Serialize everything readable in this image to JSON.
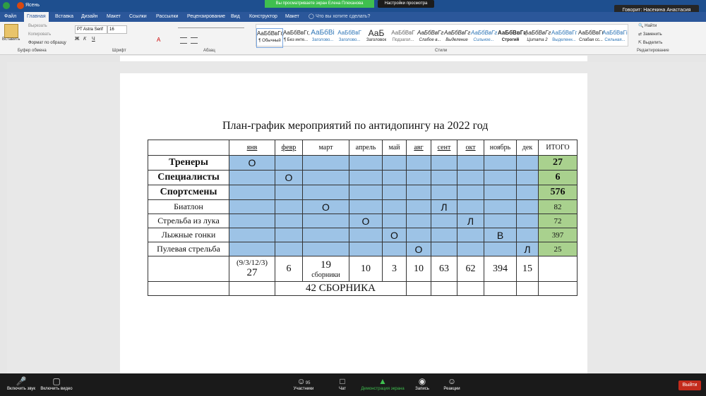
{
  "meeting": {
    "share_banner": "Вы просматриваете экран Елена Плеханова",
    "view_options": "Настройки просмотра",
    "speaker": "Говорит: Насекина Анастасия"
  },
  "word": {
    "title_left": "Ясень",
    "tabs": [
      "Файл",
      "Главная",
      "Вставка",
      "Дизайн",
      "Макет",
      "Ссылки",
      "Рассылки",
      "Рецензирование",
      "Вид",
      "Конструктор",
      "Макет"
    ],
    "tell_me": "Что вы хотите сделать?",
    "clipboard": {
      "paste": "Вставить",
      "cut": "Вырезать",
      "copy": "Копировать",
      "format_painter": "Формат по образцу",
      "group": "Буфер обмена"
    },
    "font": {
      "name": "PT Astra Serif",
      "size": "16",
      "group": "Шрифт"
    },
    "paragraph_group": "Абзац",
    "styles_group": "Стили",
    "styles": [
      {
        "sample": "АаБбВвГг,",
        "name": "¶ Обычный"
      },
      {
        "sample": "АаБбВвГг,",
        "name": "¶ Без инте..."
      },
      {
        "sample": "АаБбВі",
        "name": "Заголово..."
      },
      {
        "sample": "АаБбВвГ",
        "name": "Заголово..."
      },
      {
        "sample": "АаБ",
        "name": "Заголовок"
      },
      {
        "sample": "АаБбВвГ",
        "name": "Подзагол..."
      },
      {
        "sample": "АаБбВвГг",
        "name": "Слабое в..."
      },
      {
        "sample": "АаБбВвГг",
        "name": "Выделение"
      },
      {
        "sample": "АаБбВвГг",
        "name": "Сильное..."
      },
      {
        "sample": "АаБбВвГг,",
        "name": "Строгий"
      },
      {
        "sample": "АаБбВвГг",
        "name": "Цитата 2"
      },
      {
        "sample": "АаБбВвГг",
        "name": "Выделенн..."
      },
      {
        "sample": "АаБбВвГг",
        "name": "Слабая сс..."
      },
      {
        "sample": "АаБбВвГі",
        "name": "Сильная..."
      }
    ],
    "editing": {
      "find": "Найти",
      "replace": "Заменить",
      "select": "Выделить",
      "group": "Редактирование"
    }
  },
  "document": {
    "title": "План-график мероприятий по антидопингу на 2022 год",
    "months": [
      "янв",
      "февр",
      "март",
      "апрель",
      "май",
      "авг",
      "сент",
      "окт",
      "ноябрь",
      "дек"
    ],
    "total_header": "ИТОГО",
    "categories": [
      {
        "label": "Тренеры",
        "marks": [
          "О",
          "",
          "",
          "",
          "",
          "",
          "",
          "",
          "",
          ""
        ],
        "total": "27"
      },
      {
        "label": "Специалисты",
        "marks": [
          "",
          "О",
          "",
          "",
          "",
          "",
          "",
          "",
          "",
          ""
        ],
        "total": "6"
      },
      {
        "label": "Спортсмены",
        "marks": [
          "",
          "",
          "",
          "",
          "",
          "",
          "",
          "",
          "",
          ""
        ],
        "total": "576"
      }
    ],
    "sports": [
      {
        "label": "Биатлон",
        "marks": [
          "",
          "",
          "О",
          "",
          "",
          "",
          "Л",
          "",
          "",
          ""
        ],
        "total": "82"
      },
      {
        "label": "Стрельба из лука",
        "marks": [
          "",
          "",
          "",
          "О",
          "",
          "",
          "",
          "Л",
          "",
          ""
        ],
        "total": "72"
      },
      {
        "label": "Лыжные гонки",
        "marks": [
          "",
          "",
          "",
          "",
          "О",
          "",
          "",
          "",
          "В",
          ""
        ],
        "total": "397"
      },
      {
        "label": "Пулевая стрельба",
        "marks": [
          "",
          "",
          "",
          "",
          "",
          "О",
          "",
          "",
          "",
          "Л"
        ],
        "total": "25"
      }
    ],
    "summary": {
      "jan_sub": "(9/3/12/3)",
      "jan": "27",
      "feb": "6",
      "mar": "19",
      "mar_sub": "сборники",
      "apr": "10",
      "may": "3",
      "aug": "10",
      "sep": "63",
      "oct": "62",
      "nov": "394",
      "dec": "15"
    },
    "footer_total": "42 СБОРНИКА"
  },
  "zoom_bar": {
    "mute": "Включить звук",
    "video": "Включить видео",
    "participants": "Участники",
    "participants_count": "95",
    "chat": "Чат",
    "share": "Демонстрация экрана",
    "record": "Запись",
    "reactions": "Реакции",
    "end": "Выйти"
  },
  "colors": {
    "blue_cell": "#9dc3e6",
    "green_cell": "#a9d18e",
    "category_text": "#843c0c",
    "total_blue": "#2e75b6",
    "word_blue": "#2b579a"
  }
}
